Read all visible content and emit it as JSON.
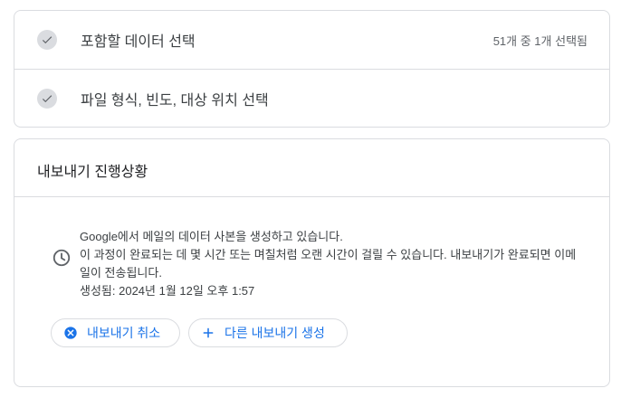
{
  "steps": [
    {
      "label": "포함할 데이터 선택",
      "meta": "51개 중 1개 선택됨",
      "icon": "check-icon"
    },
    {
      "label": "파일 형식, 빈도, 대상 위치 선택",
      "icon": "check-icon"
    }
  ],
  "progress": {
    "title": "내보내기 진행상황",
    "icon": "clock-icon",
    "message_line1": "Google에서 메일의 데이터 사본을 생성하고 있습니다.",
    "message_line2": "이 과정이 완료되는 데 몇 시간 또는 며칠처럼 오랜 시간이 걸릴 수 있습니다. 내보내기가 완료되면 이메일이 전송됩니다.",
    "created": "생성됨: 2024년 1월 12일 오후 1:57"
  },
  "buttons": {
    "cancel_label": "내보내기 취소",
    "new_export_label": "다른 내보내기 생성"
  },
  "colors": {
    "accent": "#1a73e8",
    "border": "#dadce0",
    "text": "#3c4043",
    "check_bg": "#dadce0"
  }
}
